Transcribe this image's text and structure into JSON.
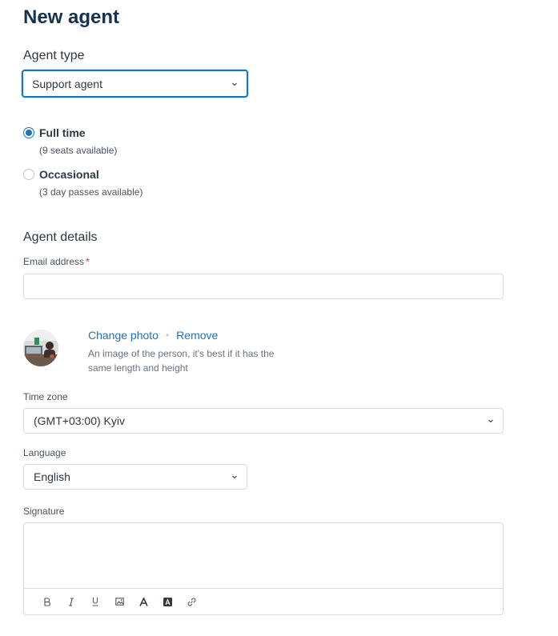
{
  "page": {
    "title": "New agent"
  },
  "agent_type": {
    "heading": "Agent type",
    "selected": "Support agent",
    "options": [
      {
        "label": "Full time",
        "hint": "(9 seats available)",
        "checked": true
      },
      {
        "label": "Occasional",
        "hint": "(3 day passes available)",
        "checked": false
      }
    ]
  },
  "details": {
    "heading": "Agent details",
    "email_label": "Email address",
    "required_mark": "*",
    "email_value": ""
  },
  "photo": {
    "change_label": "Change photo",
    "separator": "•",
    "remove_label": "Remove",
    "hint": "An image of the person, it's best if it has the same length and height"
  },
  "timezone": {
    "label": "Time zone",
    "value": "(GMT+03:00) Kyiv"
  },
  "language": {
    "label": "Language",
    "value": "English"
  },
  "signature": {
    "label": "Signature",
    "toolbar": [
      "bold-icon",
      "italic-icon",
      "underline-icon",
      "image-icon",
      "text-size-icon",
      "text-background-icon",
      "link-icon"
    ]
  },
  "colors": {
    "accent": "#1f73b7",
    "title": "#17324d",
    "border": "#d8dcde",
    "required": "#cc3340"
  }
}
